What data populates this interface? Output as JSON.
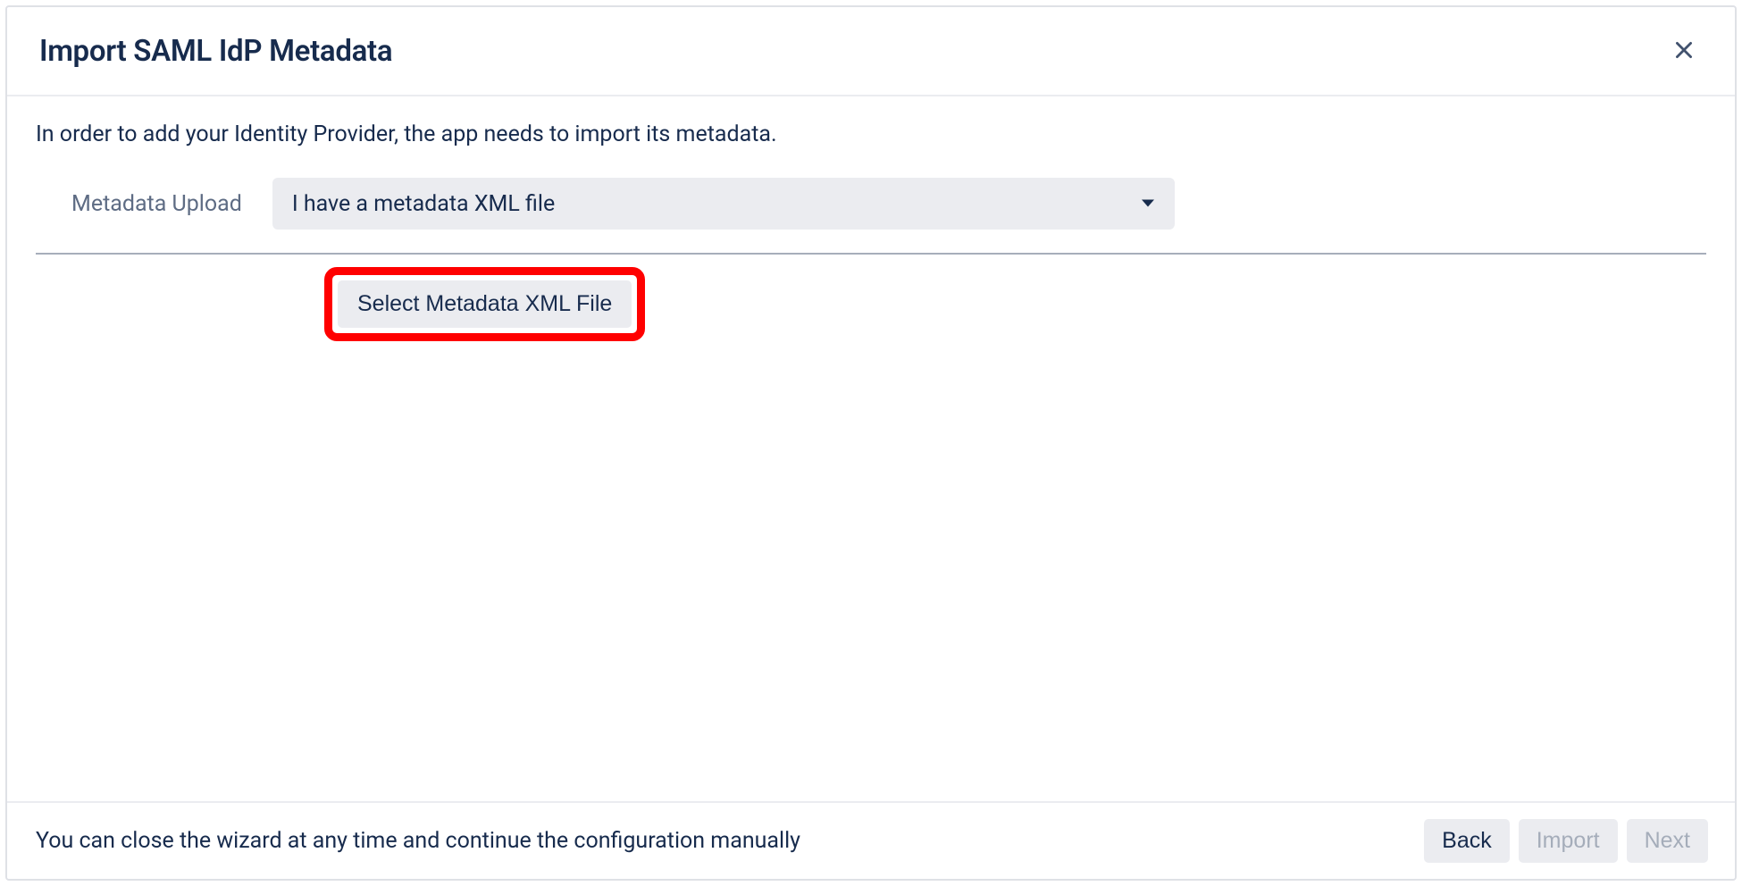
{
  "dialog": {
    "title": "Import SAML IdP Metadata",
    "intro": "In order to add your Identity Provider, the app needs to import its metadata.",
    "metadata_upload_label": "Metadata Upload",
    "metadata_upload_selected": "I have a metadata XML file",
    "select_file_label": "Select Metadata XML File",
    "hint": "You can close the wizard at any time and continue the configuration manually"
  },
  "footer": {
    "back_label": "Back",
    "import_label": "Import",
    "next_label": "Next"
  }
}
